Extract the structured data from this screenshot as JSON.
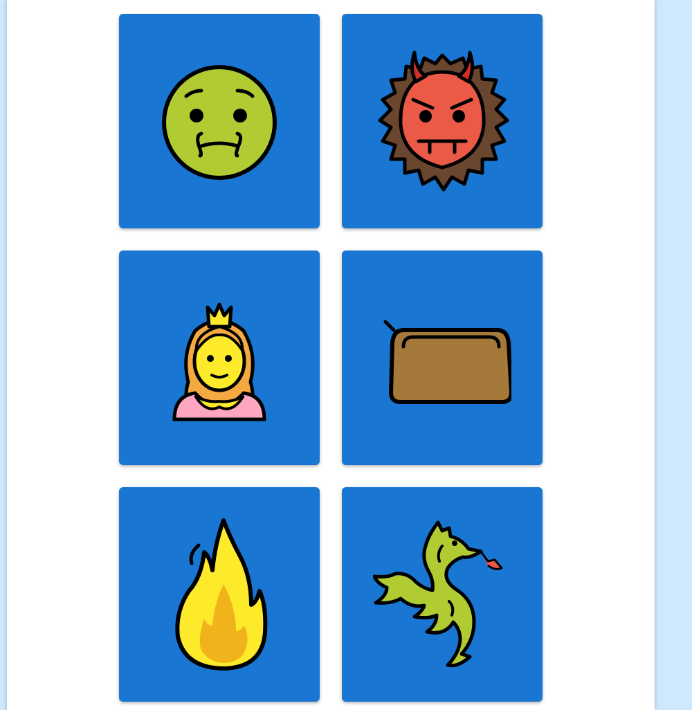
{
  "colors": {
    "card_background": "#1976d2",
    "page_background": "#cfe8fc"
  },
  "cards": [
    {
      "icon": "nauseated-face-icon"
    },
    {
      "icon": "ogre-icon"
    },
    {
      "icon": "princess-icon"
    },
    {
      "icon": "pouch-icon"
    },
    {
      "icon": "fire-icon"
    },
    {
      "icon": "dragon-icon"
    }
  ]
}
